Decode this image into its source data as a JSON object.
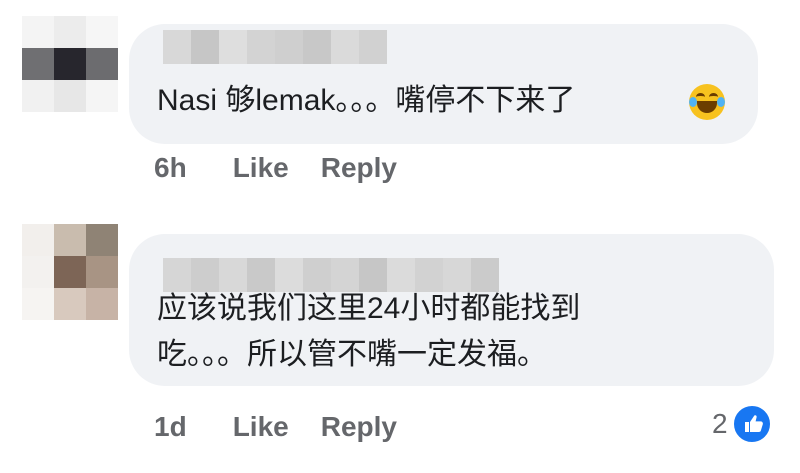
{
  "comments": [
    {
      "text": "Nasi 够lemak。。。嘴停不下来了",
      "emoji": "laughing-crying-emoji",
      "time": "6h",
      "like_label": "Like",
      "reply_label": "Reply"
    },
    {
      "text_line1": "应该说我们这里24小时都能找到",
      "text_line2": "吃。。。所以管不嘴一定发福。",
      "time": "1d",
      "like_label": "Like",
      "reply_label": "Reply",
      "reaction_count": "2",
      "reaction_icon": "thumbs-up-icon"
    }
  ],
  "colors": {
    "bubble": "#f0f2f5",
    "text": "#1c1e21",
    "meta": "#65676b",
    "like_blue": "#1877f2"
  }
}
